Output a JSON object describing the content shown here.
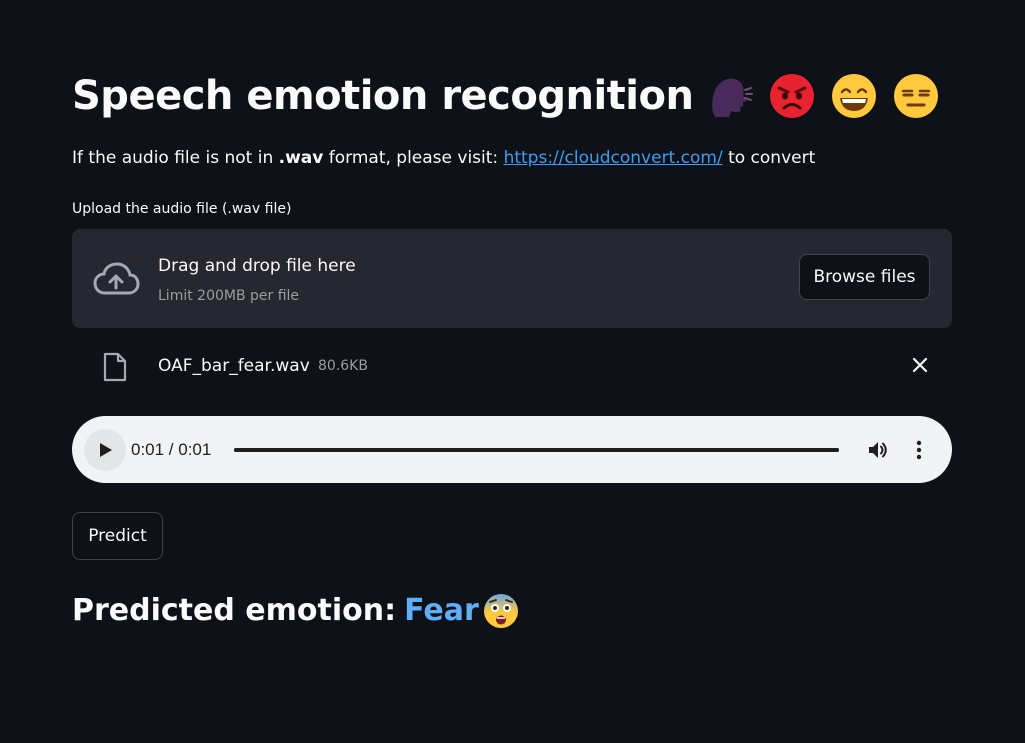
{
  "header": {
    "title": "Speech emotion recognition",
    "emojis": [
      "speaking-head-icon",
      "angry-face-icon",
      "grinning-face-icon",
      "expressionless-face-icon"
    ]
  },
  "info": {
    "prefix": "If the audio file is not in ",
    "format": ".wav",
    "middle": " format, please visit: ",
    "link_text": "https://cloudconvert.com/",
    "suffix": " to convert"
  },
  "uploader": {
    "label": "Upload the audio file (.wav file)",
    "drop_title": "Drag and drop file here",
    "drop_limit": "Limit 200MB per file",
    "browse_label": "Browse files"
  },
  "uploaded_file": {
    "name": "OAF_bar_fear.wav",
    "size": "80.6KB"
  },
  "audio_player": {
    "time_display": "0:01 / 0:01",
    "progress_fraction": 1.0
  },
  "actions": {
    "predict_label": "Predict"
  },
  "result": {
    "prefix": "Predicted emotion:",
    "emotion": "Fear",
    "emoji": "fearful-face-icon"
  },
  "colors": {
    "background": "#0e1117",
    "link": "#3d9df3",
    "emotion_text": "#61aef7",
    "dropzone": "#262730"
  }
}
